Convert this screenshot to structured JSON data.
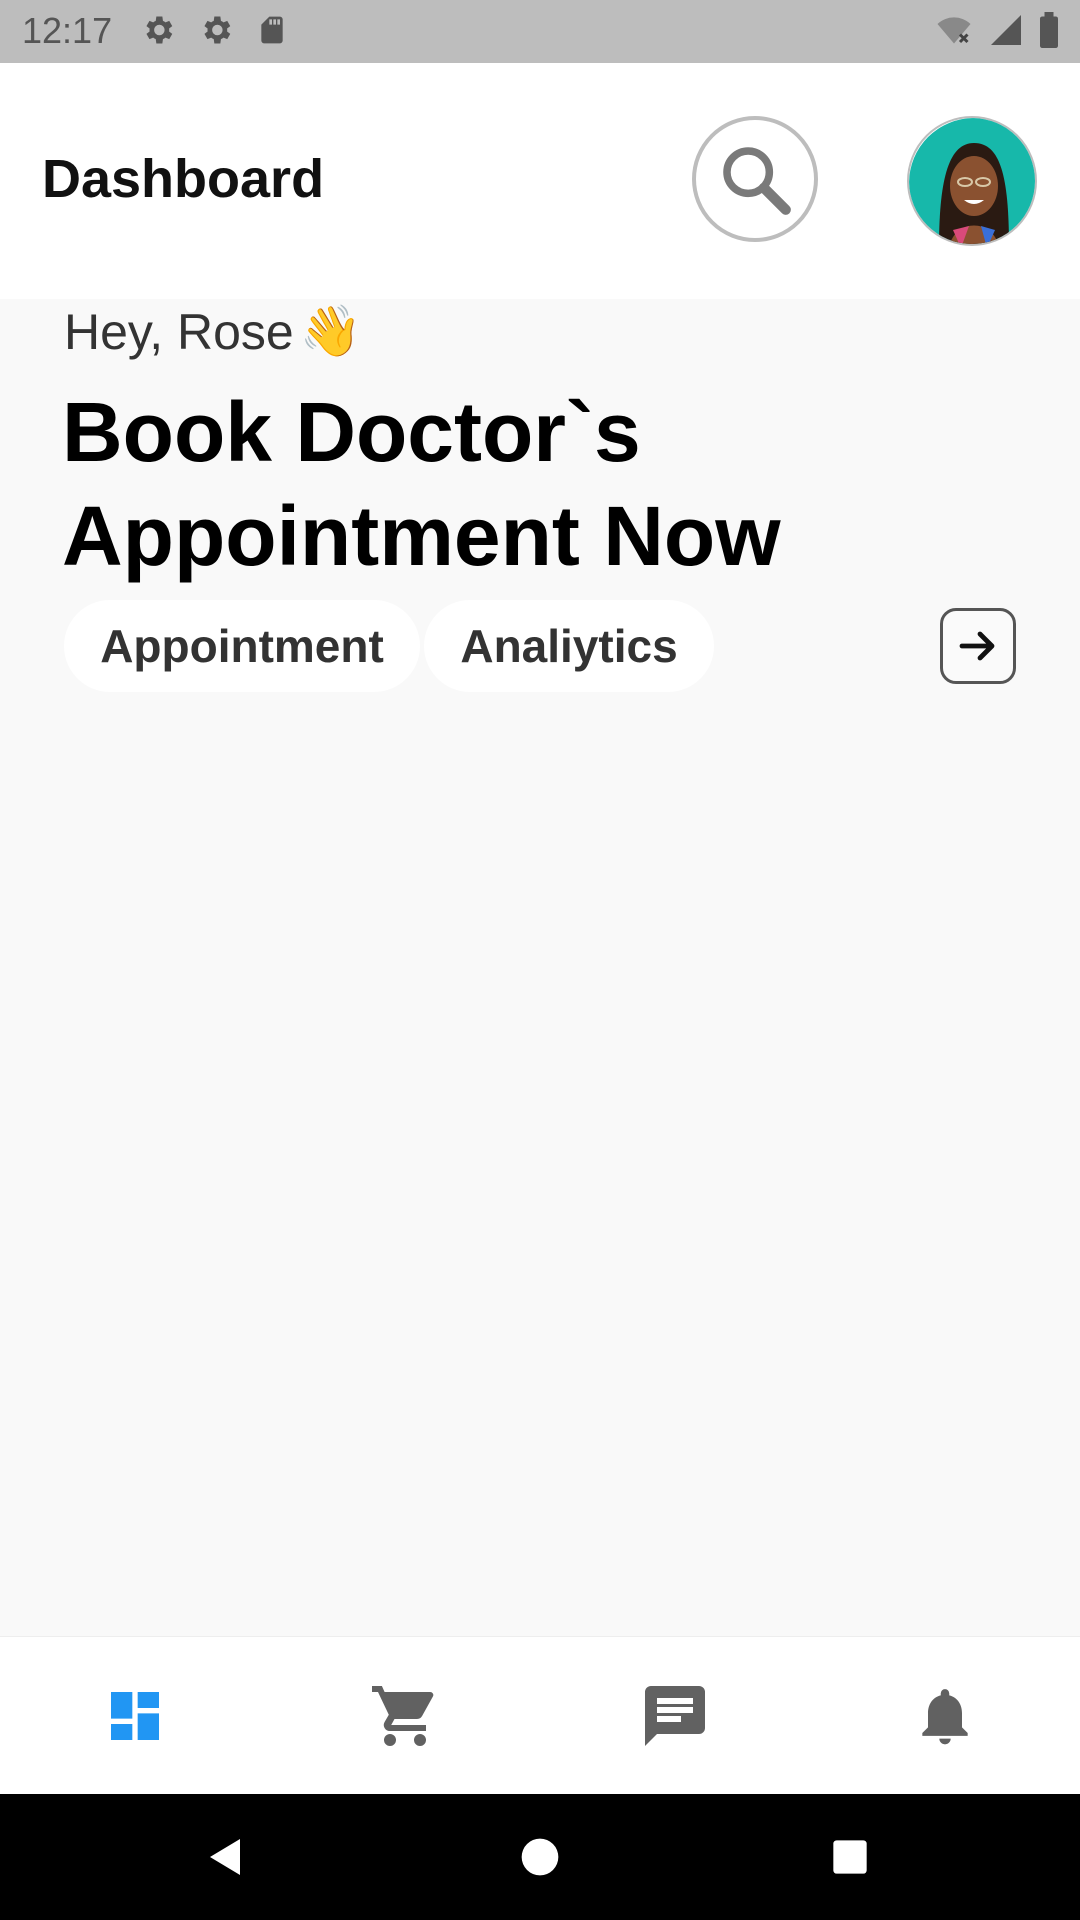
{
  "status_bar": {
    "time": "12:17",
    "icons_left": [
      "gear-icon",
      "gear-icon",
      "sd-card-icon"
    ],
    "icons_right": [
      "wifi-off-icon",
      "signal-icon",
      "battery-icon"
    ]
  },
  "header": {
    "title": "Dashboard",
    "search_icon": "search-icon",
    "avatar": "user-avatar"
  },
  "hero": {
    "greeting": "Hey, Rose",
    "wave_emoji": "👋",
    "headline_line1": "Book Doctor`s",
    "headline_line2": "Appointment Now"
  },
  "chips": [
    {
      "label": "Appointment"
    },
    {
      "label": "Analiytics"
    }
  ],
  "arrow_button_icon": "arrow-right-icon",
  "bottom_nav": {
    "items": [
      {
        "icon": "dashboard-icon",
        "active": true,
        "color": "#2196f3"
      },
      {
        "icon": "cart-icon",
        "active": false,
        "color": "#616161"
      },
      {
        "icon": "chat-icon",
        "active": false,
        "color": "#616161"
      },
      {
        "icon": "bell-icon",
        "active": false,
        "color": "#616161"
      }
    ]
  },
  "system_nav": [
    "back-icon",
    "home-icon",
    "recents-icon"
  ]
}
